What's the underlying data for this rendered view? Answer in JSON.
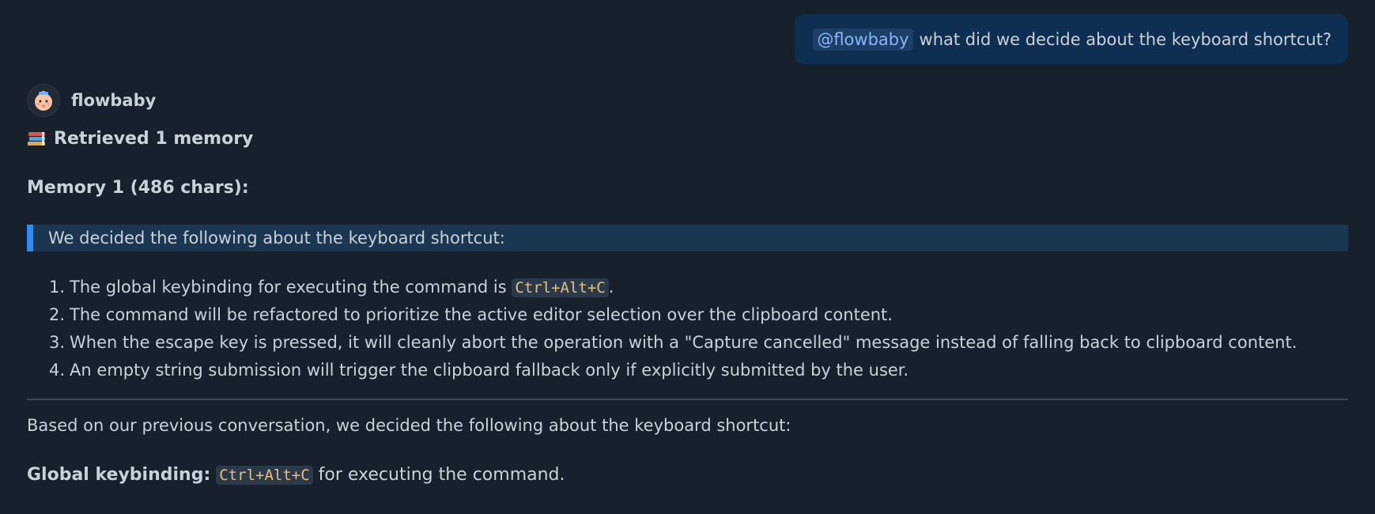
{
  "user_message": {
    "mention": "@flowbaby",
    "text": "what did we decide about the keyboard shortcut?"
  },
  "assistant": {
    "name": "flowbaby",
    "avatar_icon": "baby-face-icon"
  },
  "status": {
    "icon": "books-icon",
    "text": "Retrieved 1 memory"
  },
  "memory": {
    "title": "Memory 1 (486 chars):",
    "quote": "We decided the following about the keyboard shortcut:",
    "items": [
      {
        "num": "1.",
        "before": "The global keybinding for executing the command is",
        "code": "Ctrl+Alt+C",
        "after": "."
      },
      {
        "num": "2.",
        "text": "The command will be refactored to prioritize the active editor selection over the clipboard content."
      },
      {
        "num": "3.",
        "text": "When the escape key is pressed, it will cleanly abort the operation with a \"Capture cancelled\" message instead of falling back to clipboard content."
      },
      {
        "num": "4.",
        "text": "An empty string submission will trigger the clipboard fallback only if explicitly submitted by the user."
      }
    ]
  },
  "answer": {
    "intro": "Based on our previous conversation, we decided the following about the keyboard shortcut:",
    "keybinding_label": "Global keybinding:",
    "keybinding_code": "Ctrl+Alt+C",
    "keybinding_rest": "for executing the command."
  },
  "colors": {
    "background": "#16212b",
    "user_bubble": "#0f2f52",
    "quote_bar": "#2f8cff",
    "code_text": "#e5c07b"
  }
}
